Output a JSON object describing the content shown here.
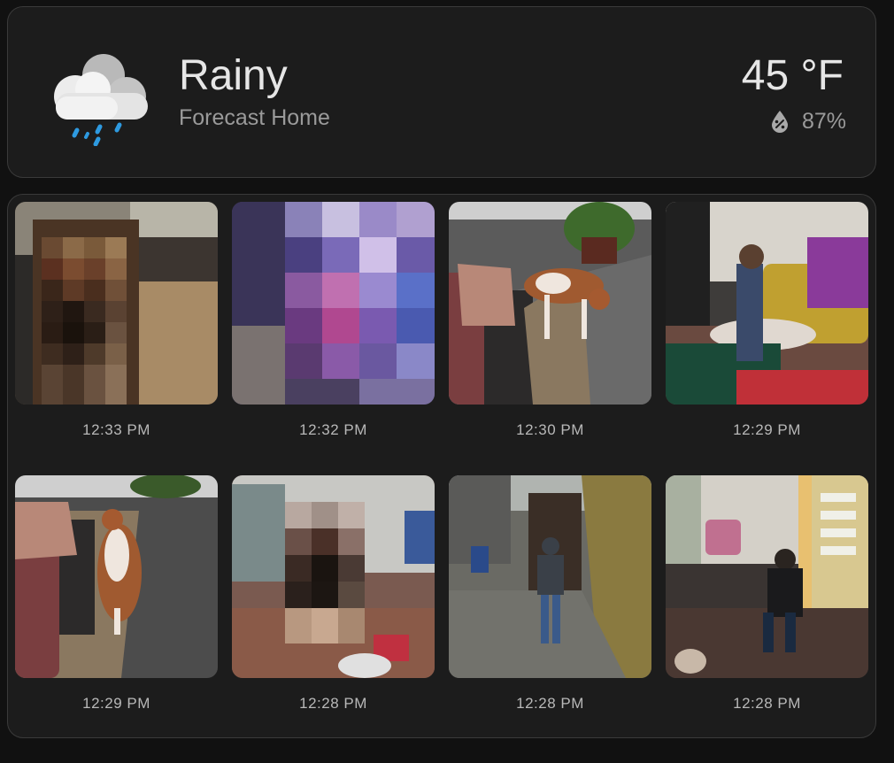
{
  "weather": {
    "condition": "Rainy",
    "location": "Forecast Home",
    "temperature": "45 °F",
    "humidity": "87%",
    "icon": "rain-cloud-icon",
    "humidity_icon": "humidity-drop-icon"
  },
  "cameras": [
    {
      "time": "12:33 PM",
      "scene": "kitchen with pixelated person"
    },
    {
      "time": "12:32 PM",
      "scene": "pixelated close-up"
    },
    {
      "time": "12:30 PM",
      "scene": "dog walking in living room"
    },
    {
      "time": "12:29 PM",
      "scene": "child in living room"
    },
    {
      "time": "12:29 PM",
      "scene": "dog on rug"
    },
    {
      "time": "12:28 PM",
      "scene": "pixelated person in living room"
    },
    {
      "time": "12:28 PM",
      "scene": "person walking in alley"
    },
    {
      "time": "12:28 PM",
      "scene": "person at front door with dog"
    }
  ],
  "colors": {
    "background": "#111111",
    "card": "#1c1c1c",
    "card_border": "#3a3a3a",
    "rain": "#2e9ae0"
  }
}
